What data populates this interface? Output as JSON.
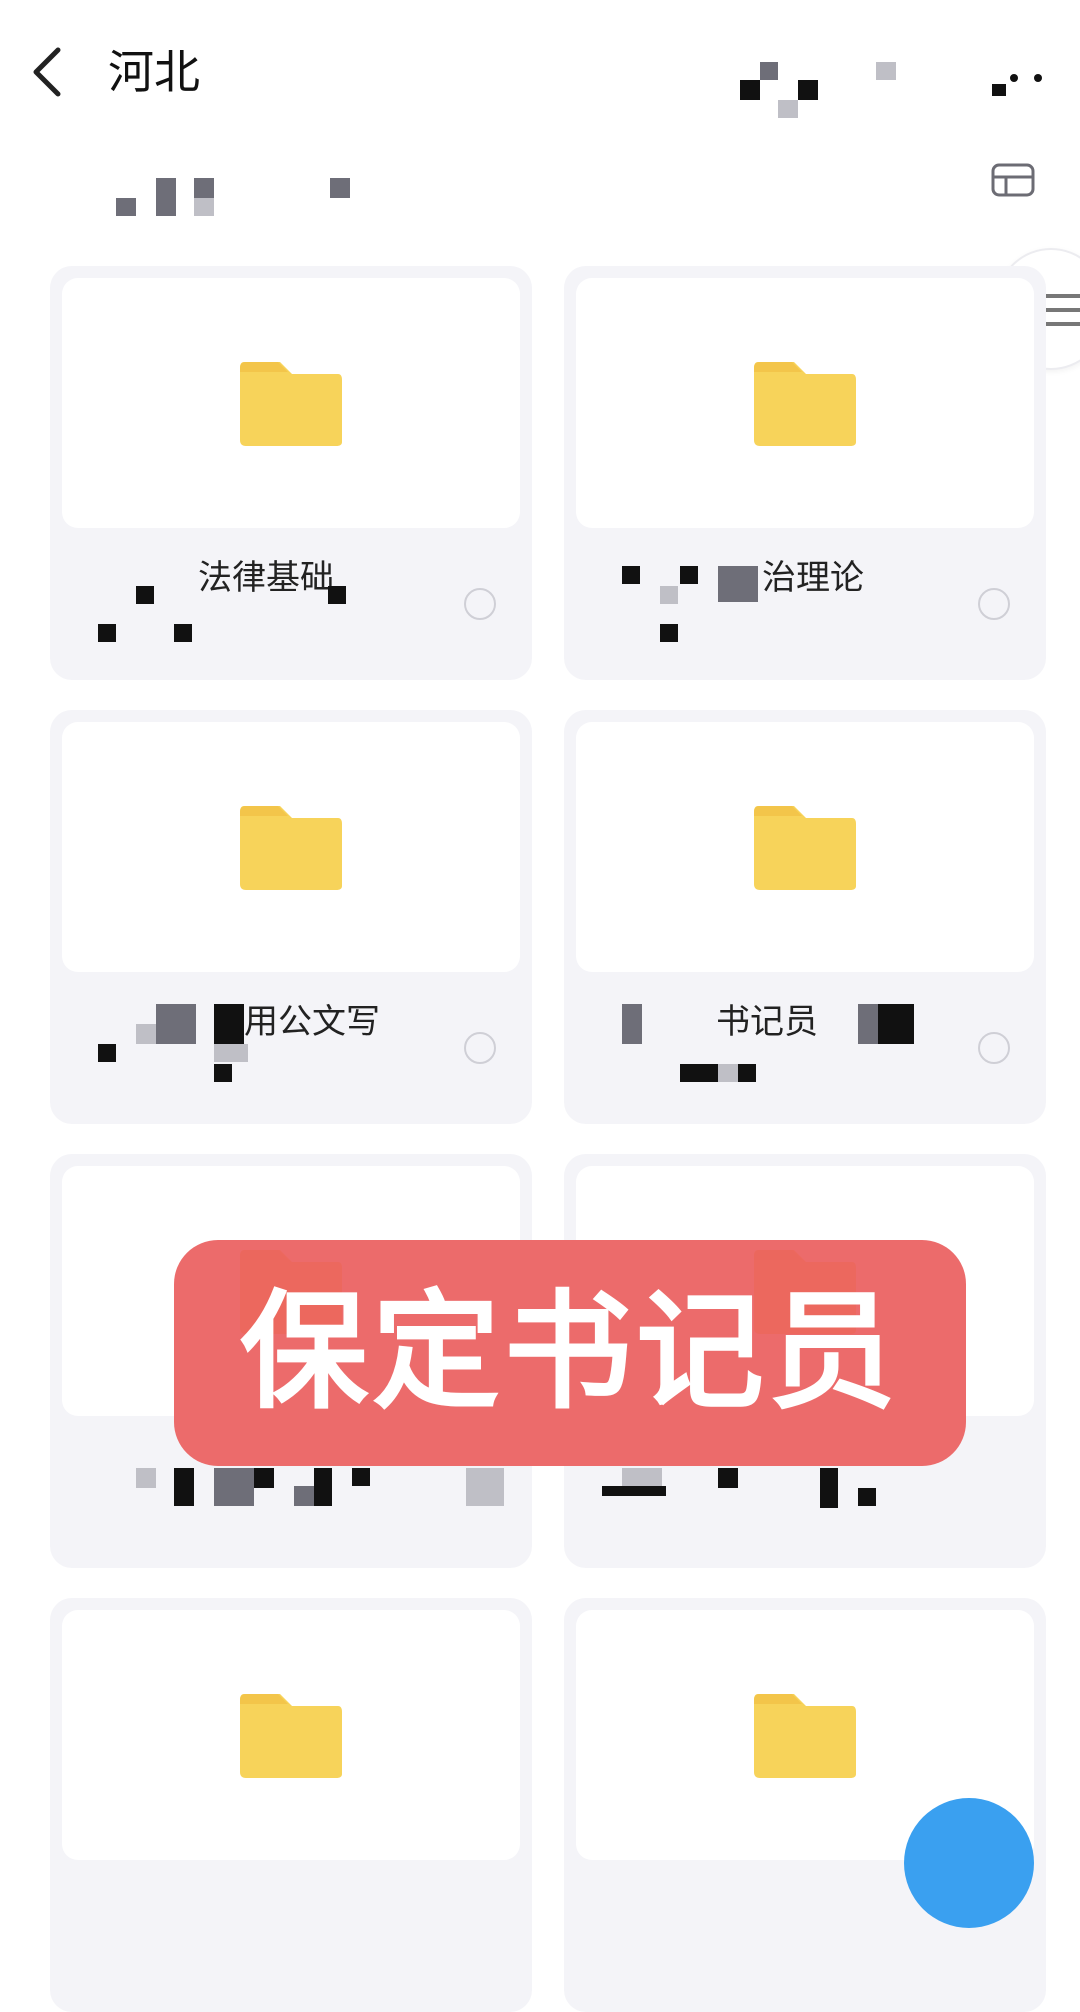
{
  "header": {
    "title": "河北"
  },
  "cards": [
    {
      "name": "法律基础"
    },
    {
      "name": "治理论"
    },
    {
      "name": "用公文写"
    },
    {
      "name": "书记员"
    },
    {
      "name": ""
    },
    {
      "name": ""
    },
    {
      "name": ""
    },
    {
      "name": ""
    }
  ],
  "banner": {
    "text": "保定书记员"
  },
  "colors": {
    "folder": "#f7d35a",
    "folder_tab": "#f3c54a",
    "banner": "#ea5e5e",
    "card_bg": "#f4f4f8"
  }
}
